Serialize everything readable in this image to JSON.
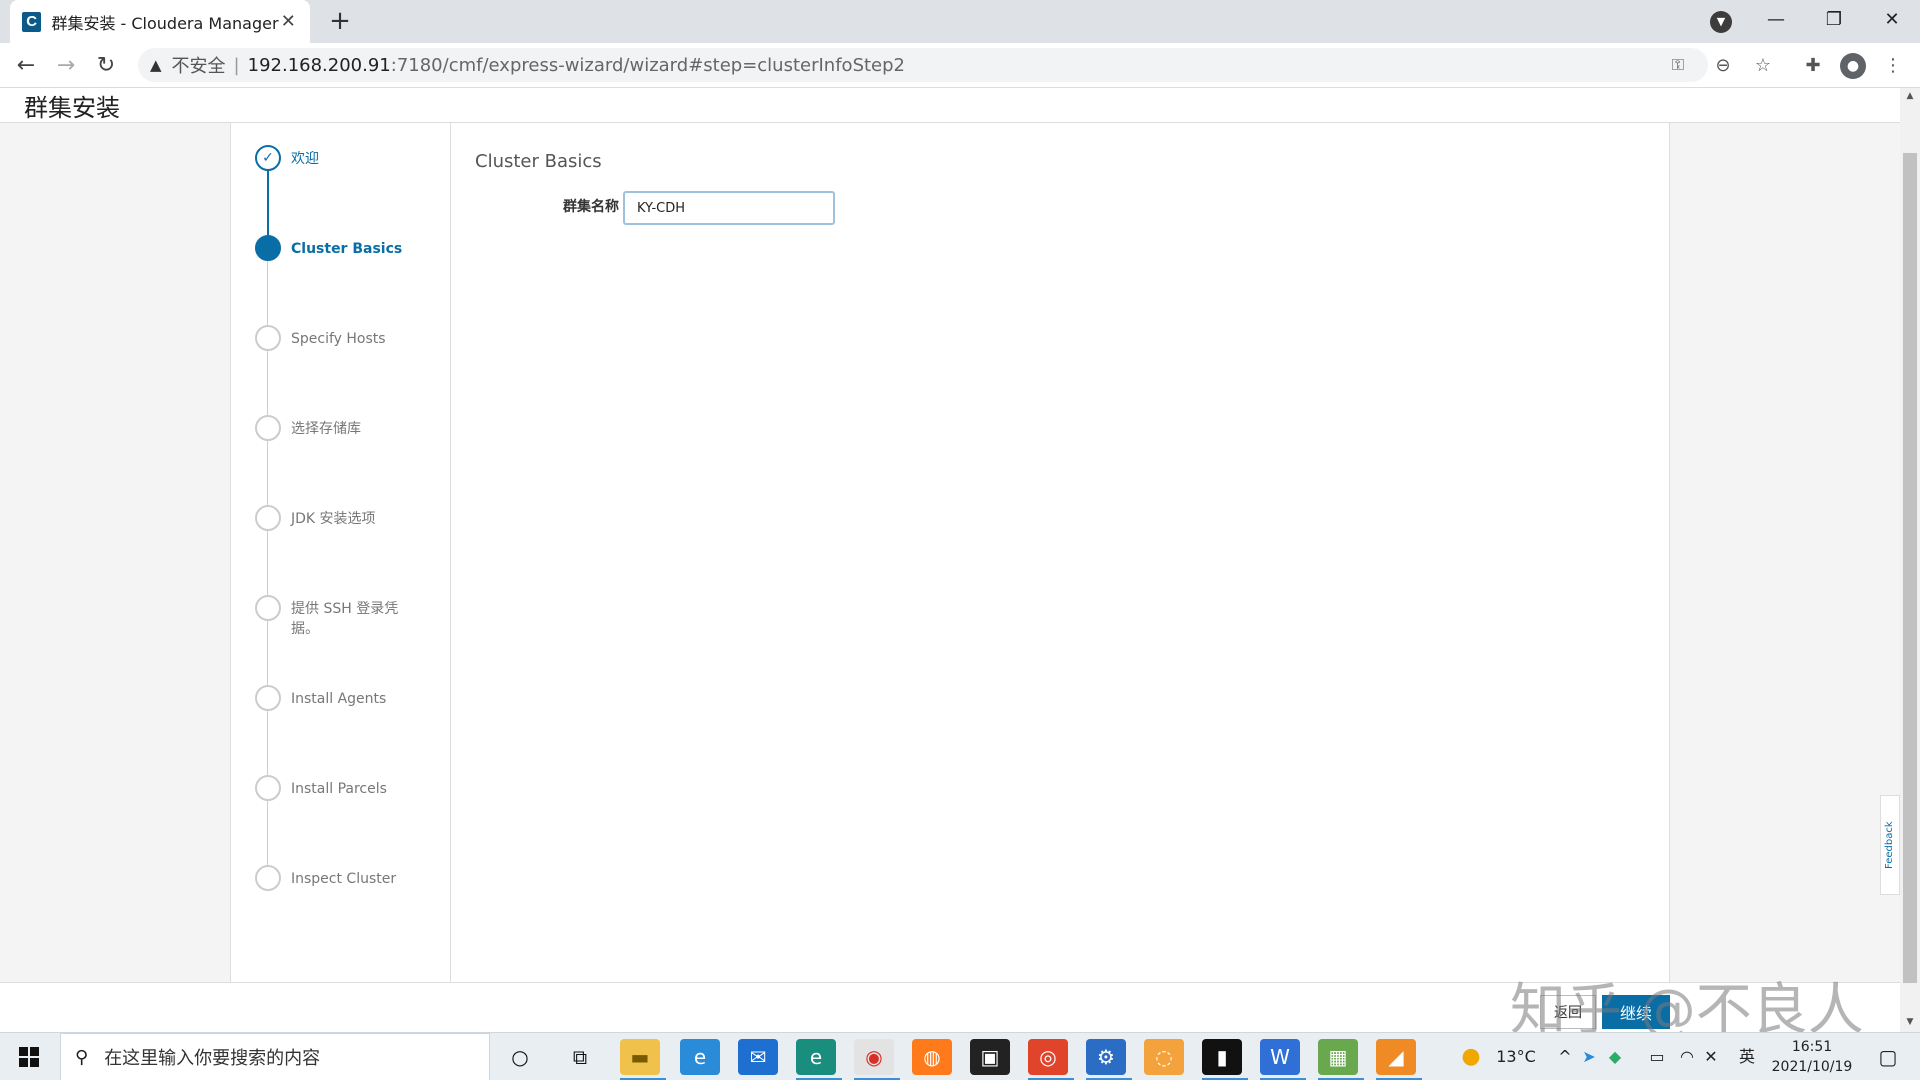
{
  "browser": {
    "tab_title": "群集安装 - Cloudera Manager",
    "tab_favicon": "C",
    "insecure_label": "不安全",
    "url_host": "192.168.200.91",
    "url_path": ":7180/cmf/express-wizard/wizard#step=clusterInfoStep2"
  },
  "page": {
    "title": "群集安装",
    "steps": [
      {
        "label": "欢迎",
        "state": "done"
      },
      {
        "label": "Cluster Basics",
        "state": "active"
      },
      {
        "label": "Specify Hosts",
        "state": "pending"
      },
      {
        "label": "选择存储库",
        "state": "pending"
      },
      {
        "label": "JDK 安装选项",
        "state": "pending"
      },
      {
        "label": "提供 SSH 登录凭据。",
        "state": "pending"
      },
      {
        "label": "Install Agents",
        "state": "pending"
      },
      {
        "label": "Install Parcels",
        "state": "pending"
      },
      {
        "label": "Inspect Cluster",
        "state": "pending"
      }
    ],
    "section_title": "Cluster Basics",
    "cluster_name_label": "群集名称",
    "cluster_name_value": "KY-CDH",
    "feedback_label": "Feedback",
    "back_label": "返回",
    "continue_label": "继续"
  },
  "watermark": "知乎 @不良人",
  "taskbar": {
    "search_placeholder": "在这里输入你要搜索的内容",
    "weather": "13°C",
    "ime": "英",
    "time": "16:51",
    "date": "2021/10/19"
  },
  "colors": {
    "accent": "#0a6ea6",
    "page_bg": "#f4f4f4"
  }
}
